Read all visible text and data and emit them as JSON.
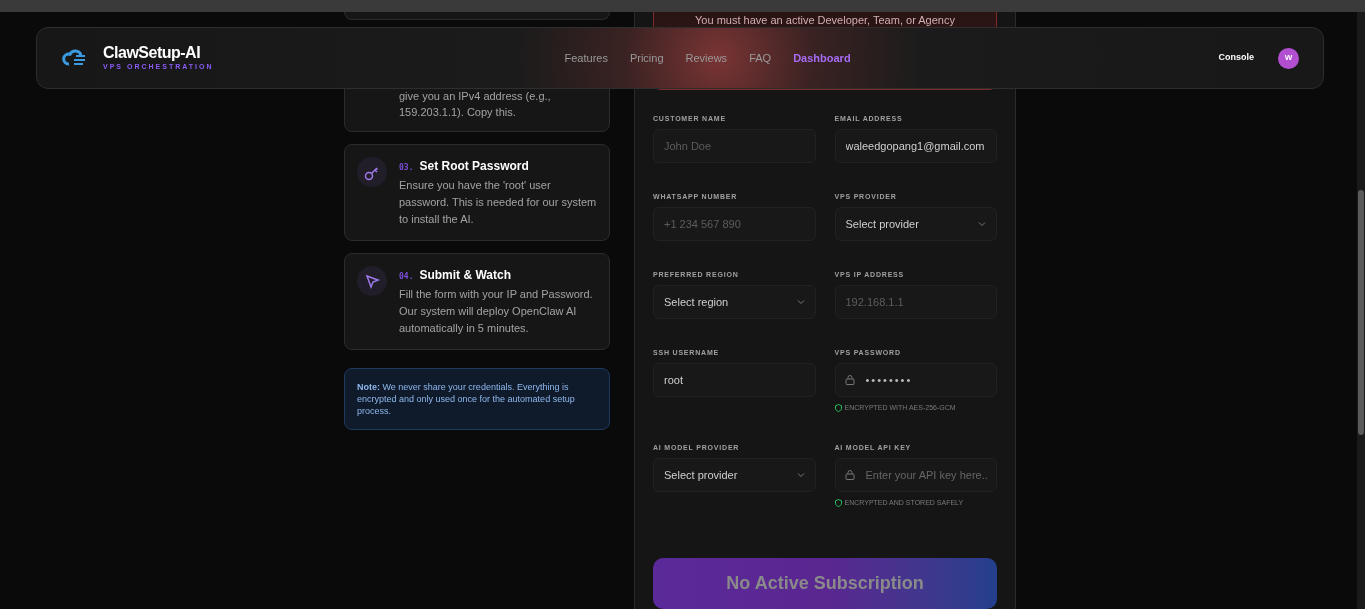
{
  "navbar": {
    "brand": "ClawSetup-AI",
    "tagline": "VPS ORCHESTRATION",
    "links": [
      {
        "label": "Features",
        "selected": false
      },
      {
        "label": "Pricing",
        "selected": false
      },
      {
        "label": "Reviews",
        "selected": false
      },
      {
        "label": "FAQ",
        "selected": false
      },
      {
        "label": "Dashboard",
        "selected": true
      }
    ],
    "console": "Console",
    "avatar": "W"
  },
  "steps_partial": {
    "text": "give you an IPv4 address (e.g., 159.203.1.1). Copy this."
  },
  "steps": [
    {
      "number": "03.",
      "title": "Set Root Password",
      "text": "Ensure you have the 'root' user password. This is needed for our system to install the AI.",
      "kind": "key"
    },
    {
      "number": "04.",
      "title": "Submit & Watch",
      "text": "Fill the form with your IP and Password. Our system will deploy OpenClaw AI automatically in 5 minutes.",
      "kind": "send"
    }
  ],
  "note": "**Note:** We never share your credentials. Everything is encrypted and only used once for the automated setup process.",
  "alert": "You must have an active Developer, Team, or Agency",
  "fields": [
    {
      "label": "CUSTOMER NAME",
      "kind": "text",
      "placeholder": "John Doe"
    },
    {
      "label": "EMAIL ADDRESS",
      "kind": "text",
      "value": "waleedgopang1@gmail.com"
    },
    {
      "label": "WHATSAPP NUMBER",
      "kind": "text",
      "placeholder": "+1 234 567 890"
    },
    {
      "label": "VPS PROVIDER",
      "kind": "select",
      "value": "Select provider"
    },
    {
      "label": "PREFERRED REGION",
      "kind": "select",
      "value": "Select region"
    },
    {
      "label": "VPS IP ADDRESS",
      "kind": "text",
      "placeholder": "192.168.1.1"
    },
    {
      "label": "SSH USERNAME",
      "kind": "text",
      "value": "root"
    },
    {
      "label": "VPS PASSWORD",
      "kind": "secret",
      "value": "••••••••",
      "hint": "ENCRYPTED WITH AES-256-GCM"
    },
    {
      "label": "AI MODEL PROVIDER",
      "kind": "select",
      "value": "Select provider"
    },
    {
      "label": "AI MODEL API KEY",
      "kind": "secret",
      "placeholder": "Enter your API key here..",
      "hint": "ENCRYPTED AND STORED SAFELY"
    }
  ],
  "submit": {
    "label": "No Active Subscription",
    "disabled": true
  }
}
